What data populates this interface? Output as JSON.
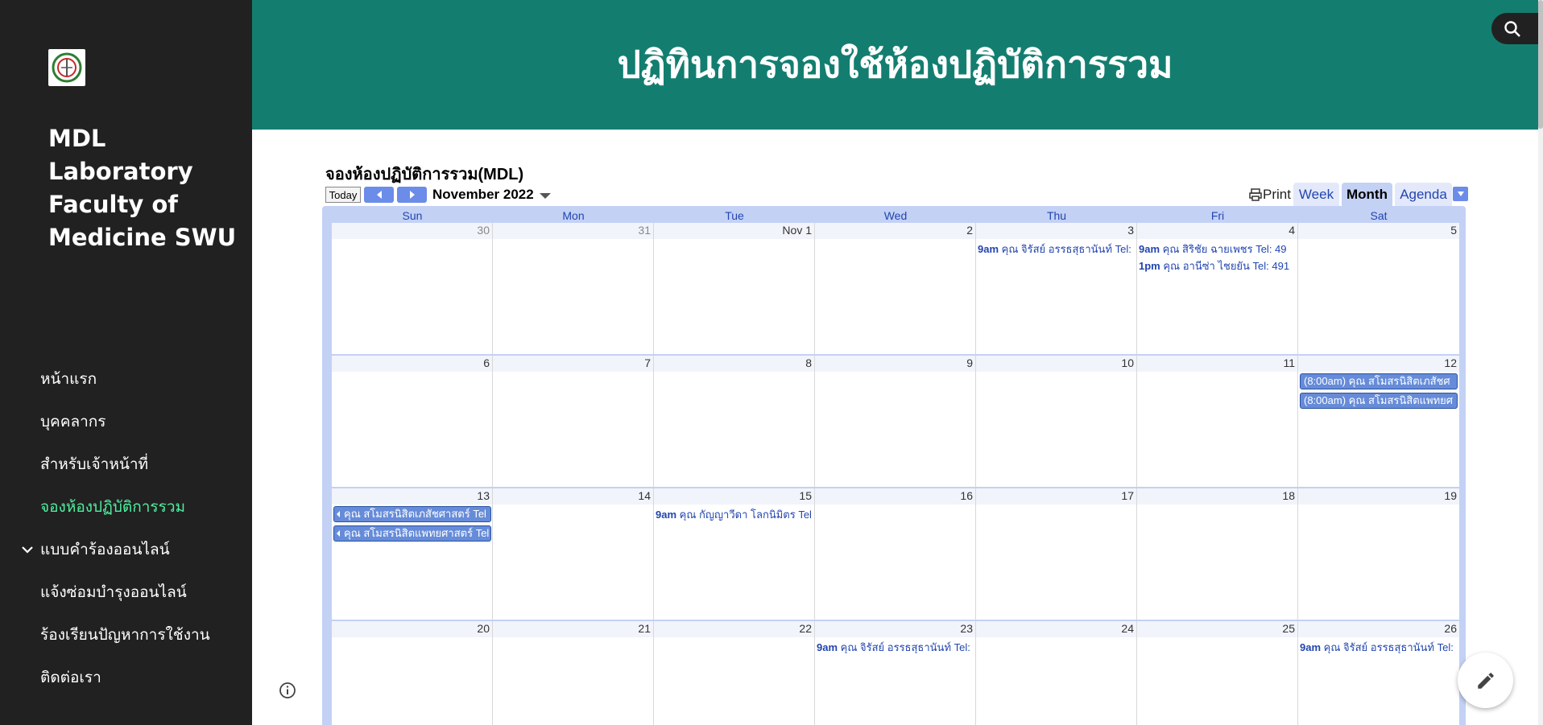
{
  "site": {
    "title": "MDL Laboratory Faculty of Medicine SWU",
    "logo_icon": "crest-logo-icon"
  },
  "banner": {
    "title": "ปฏิทินการจองใช้ห้องปฏิบัติการรวม"
  },
  "nav": {
    "items": [
      {
        "label": "หน้าแรก"
      },
      {
        "label": "บุคคลากร"
      },
      {
        "label": "สำหรับเจ้าหน้าที่"
      },
      {
        "label": "จองห้องปฏิบัติการรวม"
      },
      {
        "label": "แบบคำร้องออนไลน์"
      },
      {
        "label": "แจ้งซ่อมบำรุงออนไลน์"
      },
      {
        "label": "ร้องเรียนปัญหาการใช้งาน"
      },
      {
        "label": "ติดต่อเรา"
      }
    ],
    "active_color": "#4ef0a0"
  },
  "calendar": {
    "title": "จองห้องปฏิบัติการรวม(MDL)",
    "today_label": "Today",
    "month_label": "November 2022",
    "print_label": "Print",
    "views": {
      "week": "Week",
      "month": "Month",
      "agenda": "Agenda"
    },
    "days_of_week": [
      "Sun",
      "Mon",
      "Tue",
      "Wed",
      "Thu",
      "Fri",
      "Sat"
    ],
    "weeks": [
      [
        "30",
        "31",
        "Nov 1",
        "2",
        "3",
        "4",
        "5"
      ],
      [
        "6",
        "7",
        "8",
        "9",
        "10",
        "11",
        "12"
      ],
      [
        "13",
        "14",
        "15",
        "16",
        "17",
        "18",
        "19"
      ],
      [
        "20",
        "21",
        "22",
        "23",
        "24",
        "25",
        "26"
      ]
    ],
    "events": {
      "w0_thu_1": {
        "time": "9am",
        "text": "คุณ จิรัสย์ อรรธสุธานันท์ Tel:"
      },
      "w0_fri_1": {
        "time": "9am",
        "text": "คุณ สิริชัย ฉายเพชร Tel: 49"
      },
      "w0_fri_2": {
        "time": "1pm",
        "text": "คุณ อานีซ่า ไชยยัน Tel: 491"
      },
      "w1_sat_1": {
        "text": "(8:00am) คุณ สโมสรนิสิตเภสัชศ"
      },
      "w1_sat_2": {
        "text": "(8:00am) คุณ สโมสรนิสิตแพทยศ"
      },
      "w2_sun_1": {
        "text": "คุณ สโมสรนิสิตเภสัชศาสตร์ Tel"
      },
      "w2_sun_2": {
        "text": "คุณ สโมสรนิสิตแพทยศาสตร์ Tel"
      },
      "w2_tue_1": {
        "time": "9am",
        "text": "คุณ กัญญาวีดา โลกนิมิตร Tel"
      },
      "w3_wed_1": {
        "time": "9am",
        "text": "คุณ จิรัสย์ อรรธสุธานันท์ Tel:"
      },
      "w3_sat_1": {
        "time": "9am",
        "text": "คุณ จิรัสย์ อรรธสุธานันท์ Tel:"
      }
    },
    "colors": {
      "header_bg": "#c3d1f5",
      "event_bar": "#668cd9",
      "link": "#2245b0"
    }
  },
  "banner_color": "#137e70",
  "sidebar_color": "#212121"
}
